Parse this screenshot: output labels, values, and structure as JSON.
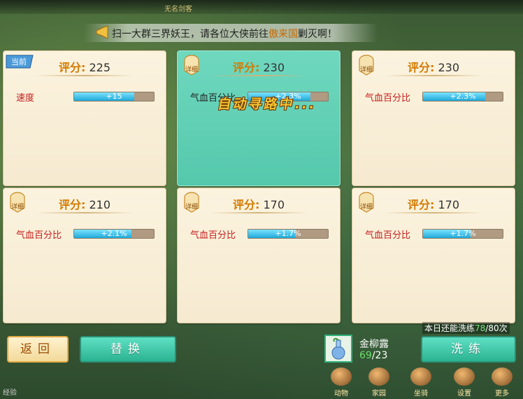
{
  "top_strip": {
    "text1": "无名剑客",
    "text2": ""
  },
  "notice": {
    "prefix": "扫一大群三界妖王，请各位大侠前往",
    "highlight": "傲来国",
    "suffix": "剿灭啊！"
  },
  "cards": [
    {
      "badge": "当前",
      "score_label": "评分:",
      "score": "225",
      "stat": "速度",
      "value": "+15",
      "fill": 0.75,
      "selected": false
    },
    {
      "badge": "详细",
      "score_label": "评分:",
      "score": "230",
      "stat": "气血百分比",
      "value": "+2.3%",
      "fill": 0.78,
      "selected": true
    },
    {
      "badge": "详细",
      "score_label": "评分:",
      "score": "230",
      "stat": "气血百分比",
      "value": "+2.3%",
      "fill": 0.78,
      "selected": false
    },
    {
      "badge": "详细",
      "score_label": "评分:",
      "score": "210",
      "stat": "气血百分比",
      "value": "+2.1%",
      "fill": 0.72,
      "selected": false
    },
    {
      "badge": "详细",
      "score_label": "评分:",
      "score": "170",
      "stat": "气血百分比",
      "value": "+1.7%",
      "fill": 0.6,
      "selected": false
    },
    {
      "badge": "详细",
      "score_label": "评分:",
      "score": "170",
      "stat": "气血百分比",
      "value": "+1.7%",
      "fill": 0.6,
      "selected": false
    }
  ],
  "autopath": "自动寻路中...",
  "buttons": {
    "back": "返回",
    "replace": "替换",
    "wash": "洗练"
  },
  "wash_info": {
    "prefix": "本日还能洗练",
    "remaining": "78",
    "total": "/80次"
  },
  "item": {
    "name": "金柳露",
    "have": "69",
    "need": "/23",
    "icon": "vase-icon"
  },
  "bottom_icons": [
    "动物",
    "家园",
    "坐骑",
    "设置",
    "更多"
  ],
  "bottom_left": "经验"
}
